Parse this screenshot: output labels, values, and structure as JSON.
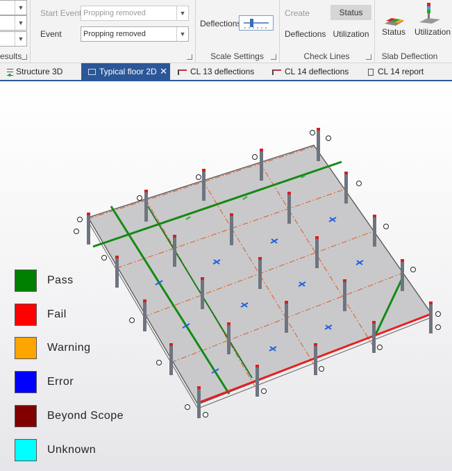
{
  "ribbon": {
    "results_group_label": "esults",
    "start_event_label": "Start Event",
    "start_event_value": "Propping removed",
    "event_label": "Event",
    "event_value": "Propping removed",
    "deflections_label": "Deflections",
    "scale_group_label": "Scale Settings",
    "create_label": "Create",
    "deflections_button": "Deflections",
    "status_label": "Status",
    "utilization_label": "Utilization",
    "check_lines_group_label": "Check Lines",
    "slab_status_label": "Status",
    "slab_utilization_label": "Utilization",
    "slab_deflection_group_label": "Slab Deflection"
  },
  "tabs": [
    {
      "label": "Structure 3D",
      "icon": "structure-3d-icon"
    },
    {
      "label": "Typical floor 2D",
      "icon": "floor-plan-icon",
      "active": true
    },
    {
      "label": "CL 13 deflections",
      "icon": "deflection-icon"
    },
    {
      "label": "CL 14 deflections",
      "icon": "deflection-icon"
    },
    {
      "label": "CL 14 report",
      "icon": "report-icon"
    }
  ],
  "legend": [
    {
      "label": "Pass",
      "color": "#008000"
    },
    {
      "label": "Fail",
      "color": "#ff0000"
    },
    {
      "label": "Warning",
      "color": "#ffa500"
    },
    {
      "label": "Error",
      "color": "#0000ff"
    },
    {
      "label": "Beyond Scope",
      "color": "#800000"
    },
    {
      "label": "Unknown",
      "color": "#00ffff"
    }
  ]
}
